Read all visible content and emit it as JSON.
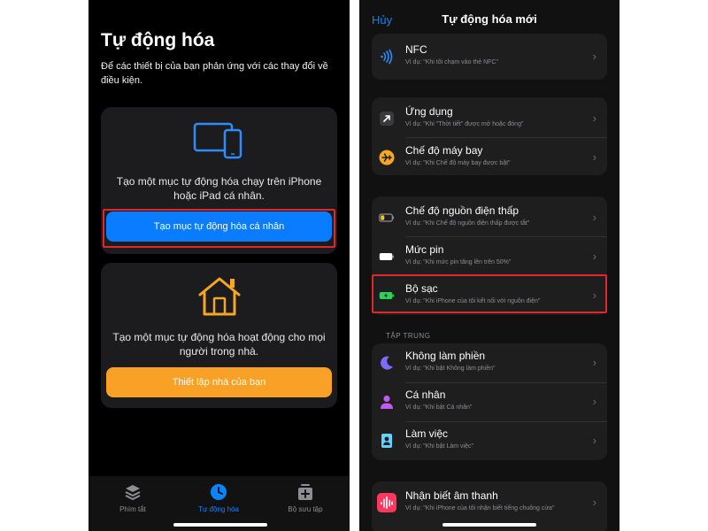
{
  "left": {
    "title": "Tự động hóa",
    "subtitle": "Để các thiết bị của bạn phản ứng với các thay đổi về điều kiện.",
    "personal_card": {
      "icon": "iphone-ipad-icon",
      "text": "Tạo một mục tự động hóa chạy trên iPhone hoặc iPad cá nhân.",
      "button": "Tạo mục tự động hóa cá nhân"
    },
    "home_card": {
      "icon": "home-icon",
      "text": "Tạo một mục tự động hóa hoạt động cho mọi người trong nhà.",
      "button": "Thiết lập nhà của bạn"
    },
    "tabs": [
      {
        "label": "Phím tắt",
        "icon": "layers-icon",
        "active": false
      },
      {
        "label": "Tự động hóa",
        "icon": "clock-icon",
        "active": true
      },
      {
        "label": "Bộ sưu tập",
        "icon": "gallery-add-icon",
        "active": false
      }
    ]
  },
  "right": {
    "cancel": "Hủy",
    "title": "Tự động hóa mới",
    "groups": [
      [
        {
          "title": "NFC",
          "sub": "Ví dụ: \"Khi tôi chạm vào thẻ NFC\"",
          "icon": "nfc-icon"
        }
      ],
      [
        {
          "title": "Ứng dụng",
          "sub": "Ví dụ: \"Khi \"Thời tiết\" được mở hoặc đóng\"",
          "icon": "app-arrow-icon"
        },
        {
          "title": "Chế độ máy bay",
          "sub": "Ví dụ: \"Khi Chế độ máy bay được bật\"",
          "icon": "airplane-icon"
        }
      ],
      [
        {
          "title": "Chế độ nguồn điện thấp",
          "sub": "Ví dụ: \"Khi Chế độ nguồn điện thấp được tắt\"",
          "icon": "low-battery-icon"
        },
        {
          "title": "Mức pin",
          "sub": "Ví dụ: \"Khi mức pin tăng lên trên 50%\"",
          "icon": "battery-level-icon"
        },
        {
          "title": "Bộ sạc",
          "sub": "Ví dụ: \"Khi iPhone của tôi kết nối với nguồn điện\"",
          "icon": "charging-battery-icon"
        }
      ],
      [
        {
          "title": "Không làm phiền",
          "sub": "Ví dụ: \"Khi bật Không làm phiền\"",
          "icon": "moon-icon"
        },
        {
          "title": "Cá nhân",
          "sub": "Ví dụ: \"Khi bật Cá nhân\"",
          "icon": "person-icon"
        },
        {
          "title": "Làm việc",
          "sub": "Ví dụ: \"Khi bật Làm việc\"",
          "icon": "id-badge-icon"
        }
      ],
      [
        {
          "title": "Nhận biết âm thanh",
          "sub": "Ví dụ: \"Khi iPhone của tôi nhận biết tiếng chuông cửa\"",
          "icon": "sound-wave-icon"
        }
      ]
    ],
    "section_focus": "TẬP TRUNG",
    "chevron": "›"
  },
  "colors": {
    "blue_button": "#0a7cff",
    "orange_button": "#f8a126",
    "highlight_border": "#e1262c",
    "link_blue": "#0a84ff"
  }
}
